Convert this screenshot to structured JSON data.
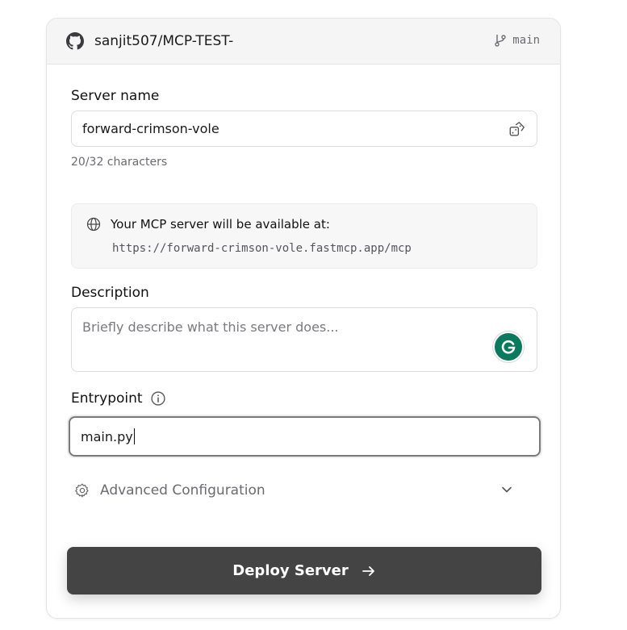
{
  "header": {
    "repo": "sanjit507/MCP-TEST-",
    "branch": "main"
  },
  "server_name": {
    "label": "Server name",
    "value": "forward-crimson-vole",
    "helper": "20/32 characters"
  },
  "availability": {
    "title": "Your MCP server will be available at:",
    "url": "https://forward-crimson-vole.fastmcp.app/mcp"
  },
  "description": {
    "label": "Description",
    "placeholder": "Briefly describe what this server does..."
  },
  "entrypoint": {
    "label": "Entrypoint",
    "value": "main.py"
  },
  "advanced": {
    "label": "Advanced Configuration"
  },
  "deploy": {
    "label": "Deploy Server"
  }
}
